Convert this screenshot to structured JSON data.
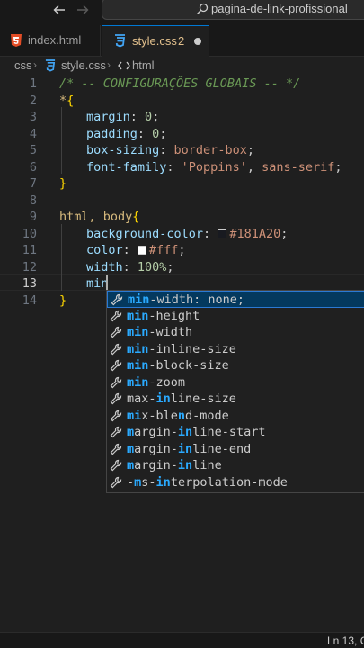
{
  "titlebar": {
    "search_text": "pagina-de-link-profissional"
  },
  "tabs": [
    {
      "label": "index.html"
    },
    {
      "label": "style.css",
      "count": "2"
    }
  ],
  "breadcrumb": {
    "folder": "css",
    "file": "style.css",
    "symbol": "html"
  },
  "editor": {
    "line_numbers": [
      "1",
      "2",
      "3",
      "4",
      "5",
      "6",
      "7",
      "8",
      "9",
      "10",
      "11",
      "12",
      "13",
      "14"
    ],
    "active_line": "13",
    "lines": {
      "l1": "/* -- CONFIGURAÇÕES GLOBAIS -- */",
      "l2_sel": "*",
      "l2_brace": "{",
      "l3_prop": "margin",
      "l3_val": "0",
      "l4_prop": "padding",
      "l4_val": "0",
      "l5_prop": "box-sizing",
      "l5_val": "border-box",
      "l6_prop": "font-family",
      "l6_str": "'Poppins'",
      "l6_val": "sans-serif",
      "l7_brace": "}",
      "l9_sel": "html, body",
      "l9_brace": "{",
      "l10_prop": "background-color",
      "l10_val": "#181A20",
      "l11_prop": "color",
      "l11_val": "#fff",
      "l12_prop": "width",
      "l12_val": "100%",
      "l13_text": "min",
      "l14_brace": "}"
    },
    "colors": {
      "swatch_bg": "#181A20",
      "swatch_fg": "#ffffff"
    }
  },
  "suggestions": [
    {
      "match": "min",
      "rest": "-width: none;"
    },
    {
      "match": "min",
      "rest": "-height"
    },
    {
      "match": "min",
      "rest": "-width"
    },
    {
      "match": "min",
      "rest": "-inline-size"
    },
    {
      "match": "min",
      "rest": "-block-size"
    },
    {
      "match": "min",
      "rest": "-zoom"
    },
    {
      "pre": "max-",
      "match": "in",
      "rest": "line-size"
    },
    {
      "pre": "",
      "match": "mi",
      "rest": "x-ble",
      "m2": "n",
      "rest2": "d-mode"
    },
    {
      "pre": "",
      "match": "m",
      "rest": "argin-",
      "m2": "in",
      "rest2": "line-start"
    },
    {
      "pre": "",
      "match": "m",
      "rest": "argin-",
      "m2": "in",
      "rest2": "line-end"
    },
    {
      "pre": "",
      "match": "m",
      "rest": "argin-",
      "m2": "in",
      "rest2": "line"
    },
    {
      "pre": "-",
      "match": "m",
      "rest": "s-",
      "m2": "in",
      "rest2": "terpolation-mode"
    }
  ],
  "statusbar": {
    "position": "Ln 13, C"
  }
}
